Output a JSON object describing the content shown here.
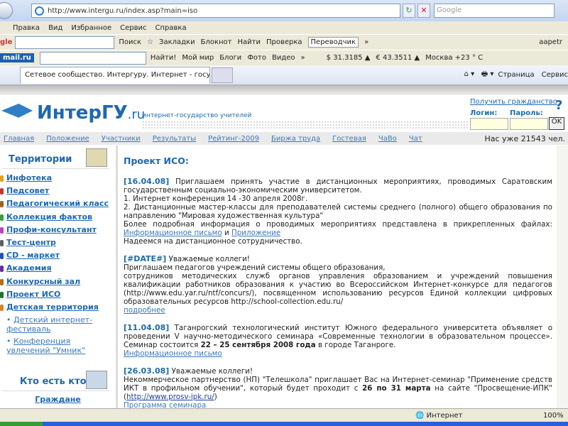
{
  "browser": {
    "url": "http://www.intergu.ru/index.asp?main=iso",
    "search_placeholder": "Google",
    "menu": [
      "Правка",
      "Вид",
      "Избранное",
      "Сервис",
      "Справка"
    ],
    "google_toolbar": {
      "search": "Поиск",
      "bookmarks": "Закладки",
      "notepad": "Блокнот",
      "find": "Найти",
      "spell": "Проверка",
      "translate": "Переводчик",
      "more": "»",
      "user": "aapetr"
    },
    "mail_toolbar": {
      "logo": "mail.ru",
      "find": "Найти!",
      "myworld": "Мой мир",
      "blogs": "Блоги",
      "photo": "Фото",
      "video": "Видео",
      "more": "»",
      "usd": "$ 31.3185 ▲",
      "eur": "€ 43.3511 ▲",
      "weather": "Москва +23 ° С"
    },
    "tab_title": "Сетевое сообщество. Интергуру. Интернет - госу...",
    "cmd": {
      "page": "Страница",
      "service": "Сервис"
    },
    "status": {
      "zone": "Интернет",
      "zoom": "100%"
    }
  },
  "site": {
    "brand": "ИнтерГУ",
    "brand_tld": ".ru",
    "slogan": "интернет-государство учителей",
    "citizenship": "Получить гражданство",
    "login_label": "Логин:",
    "password_label": "Пароль:",
    "ok": "OK",
    "help": "?",
    "nav": [
      "Главная",
      "Положение",
      "Участники",
      "Результаты",
      "Рейтинг-2009",
      "Биржа труда",
      "Гостевая",
      "ЧаВо",
      "Чат"
    ],
    "members": "Нас уже 21543 чел."
  },
  "sidebar": {
    "title": "Территории",
    "items": [
      {
        "label": "Инфотека",
        "color": "#e0a020"
      },
      {
        "label": "Педсовет",
        "color": "#d03030"
      },
      {
        "label": "Педагогический класс",
        "color": "#a06020"
      },
      {
        "label": "Коллекция фактов",
        "color": "#30a040"
      },
      {
        "label": "Профи-консультант",
        "color": "#c040c0"
      },
      {
        "label": "Тест-центр",
        "color": "#606060"
      },
      {
        "label": "CD - маркет",
        "color": "#2050c0"
      },
      {
        "label": "Академия",
        "color": "#6030a0"
      },
      {
        "label": "Конкурсный зал",
        "color": "#b07020"
      },
      {
        "label": "Проект ИСО",
        "color": "#207030"
      },
      {
        "label": "Детская территория",
        "color": "#e08020"
      }
    ],
    "subitems": [
      "Детский интернет-фестиваль",
      "Конференция увлечений \"Умник\""
    ],
    "who_title": "Кто есть кто?",
    "citizens": "Граждане"
  },
  "main": {
    "title": "Проект ИСО:",
    "news": [
      {
        "date": "[16.04.08]",
        "text": "Приглашаем принять участие в дистанционных мероприятиях, проводимых Саратовским государственным социально-экономическим университетом.",
        "l1": "1. Интернет конференция 14 -30 апреля 2008г.",
        "l2": "2. Дистанционные мастер-классы для преподавателей системы среднего (полного) общего образования по направлению \"Мировая художественная культура\"",
        "l3": "Более подробная информация о проводимых мероприятиях представлена в прикрепленных файлах:",
        "link1": "Информационное письмо",
        "and": "и",
        "link2": "Приложение",
        "l4": "Надеемся на дистанционное сотрудничество."
      },
      {
        "date": "[#DATE#]",
        "head": "Уважаемые коллеги!",
        "l1": "Приглашаем педагогов учреждений системы общего образования,",
        "l2": "сотрудников методических служб органов управления образованием и учреждений повышения квалификации работников образования к участию во Всероссийском Интернет-конкурсе для педагогов (http://www.edu.yar.ru/ntf/concurs/), посвященном использованию ресурсов Единой коллекции цифровых образовательных ресурсов http://school-collection.edu.ru/",
        "link": "подробнее"
      },
      {
        "date": "[11.04.08]",
        "text": "Таганрогский технологический институт Южного федерального университета объявляет о проведении V научно-методического семинара «Современные технологии в образовательном процессе».",
        "l1a": "Семинар состоится",
        "l1b": "22 – 25 сентября 2008 года",
        "l1c": "в городе Таганроге.",
        "link": "Информационное письмо"
      },
      {
        "date": "[26.03.08]",
        "head": "Уважаемые коллеги!",
        "t1": "Некоммерческое партнерство (НП) \"Телешкола\" приглашает Вас на Интернет-семинар \"Применение средств ИКТ в профильном обучении\", который будет проходит с",
        "b": "26 по 31 марта",
        "t2": "на сайте \"Просвещение-ИПК\" (",
        "url": "http://www.prosv-ipk.ru/",
        "t3": ")",
        "link": "Программа семинара"
      }
    ]
  }
}
